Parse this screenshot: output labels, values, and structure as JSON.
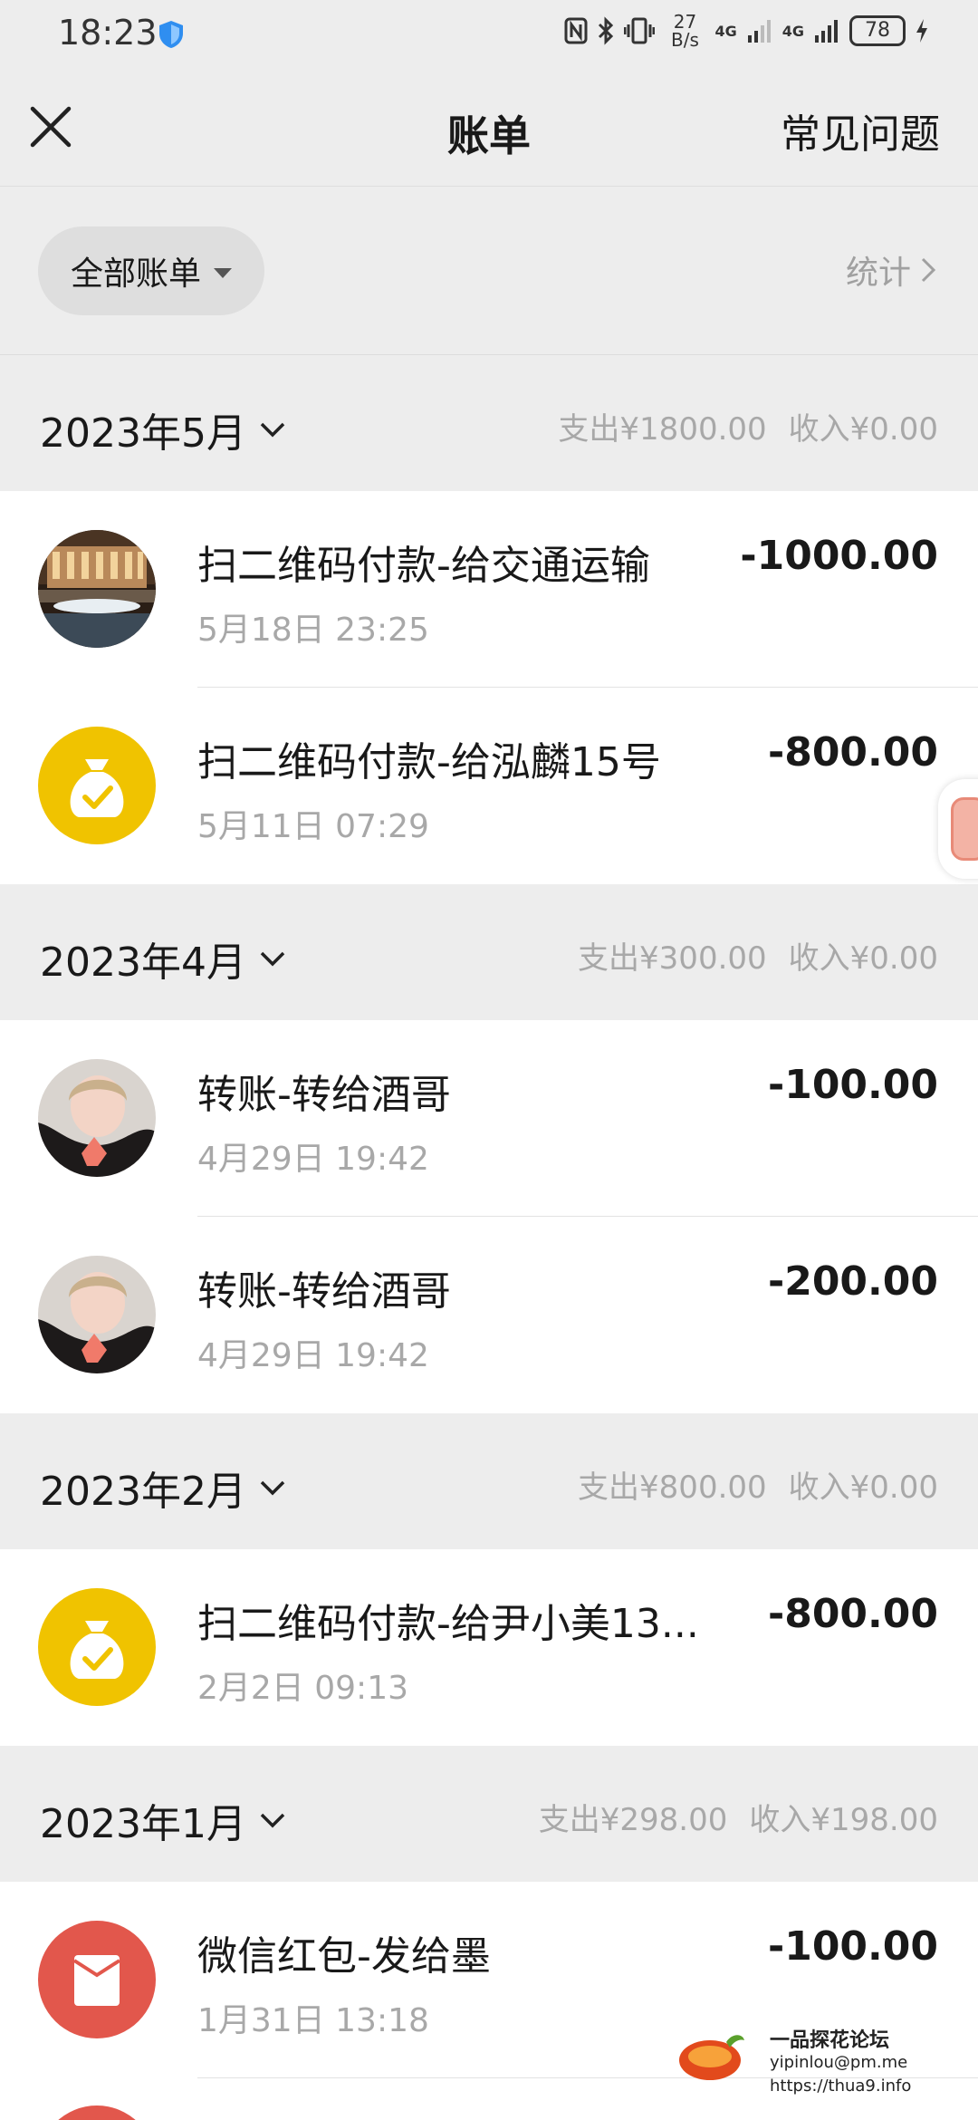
{
  "status_bar": {
    "time": "18:23",
    "net_speed_value": "27",
    "net_speed_unit": "B/s",
    "network_label_1": "4G",
    "network_label_2": "4G",
    "battery": "78"
  },
  "nav": {
    "title": "账单",
    "faq_label": "常见问题",
    "close_icon": "close-icon"
  },
  "filter": {
    "label": "全部账单",
    "stats_label": "统计"
  },
  "months": [
    {
      "label": "2023年5月",
      "expense": "支出¥1800.00",
      "income": "收入¥0.00",
      "transactions": [
        {
          "title": "扫二维码付款-给交通运输",
          "time": "5月18日 23:25",
          "amount": "-1000.00",
          "avatar": "hotel-photo"
        },
        {
          "title": "扫二维码付款-给泓麟15号",
          "time": "5月11日 07:29",
          "amount": "-800.00",
          "avatar": "money-bag-icon"
        }
      ]
    },
    {
      "label": "2023年4月",
      "expense": "支出¥300.00",
      "income": "收入¥0.00",
      "transactions": [
        {
          "title": "转账-转给酒哥",
          "time": "4月29日 19:42",
          "amount": "-100.00",
          "avatar": "person-photo"
        },
        {
          "title": "转账-转给酒哥",
          "time": "4月29日 19:42",
          "amount": "-200.00",
          "avatar": "person-photo"
        }
      ]
    },
    {
      "label": "2023年2月",
      "expense": "支出¥800.00",
      "income": "收入¥0.00",
      "transactions": [
        {
          "title": "扫二维码付款-给尹小美13...",
          "time": "2月2日 09:13",
          "amount": "-800.00",
          "avatar": "money-bag-icon"
        }
      ]
    },
    {
      "label": "2023年1月",
      "expense": "支出¥298.00",
      "income": "收入¥198.00",
      "transactions": [
        {
          "title": "微信红包-发给墨",
          "time": "1月31日 13:18",
          "amount": "-100.00",
          "avatar": "red-packet-icon"
        }
      ]
    }
  ],
  "watermark": {
    "line1": "一品探花论坛",
    "line2": "yipinlou@pm.me",
    "line3": "https://thua9.info"
  },
  "colors": {
    "page_bg": "#ededed",
    "card_bg": "#ffffff",
    "money_bag_yellow": "#f0c300",
    "red_packet": "#e2574c",
    "muted_text": "#a8a8a8"
  }
}
